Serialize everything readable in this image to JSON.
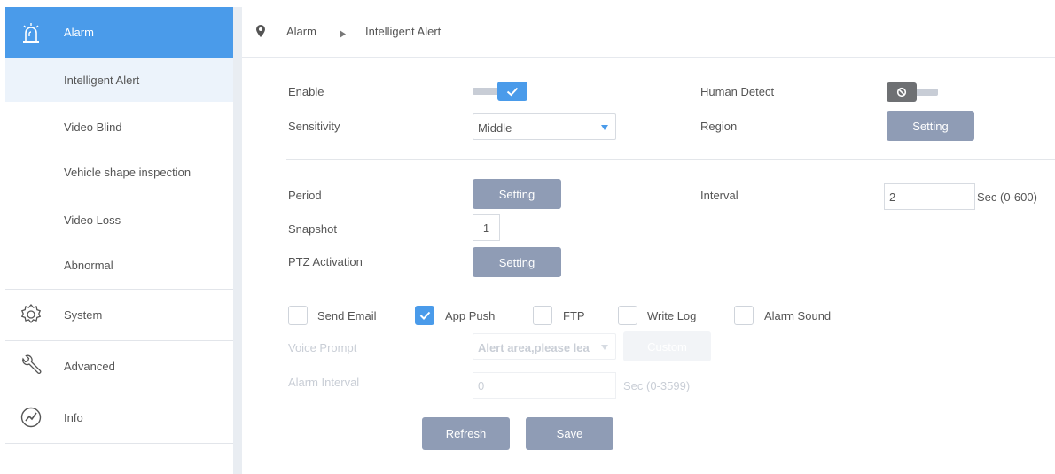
{
  "sidebar": {
    "alarm": "Alarm",
    "sub_items": [
      "Intelligent Alert",
      "Video Blind",
      "Vehicle shape inspection",
      "Video Loss",
      "Abnormal"
    ],
    "system": "System",
    "advanced": "Advanced",
    "info": "Info"
  },
  "breadcrumb": {
    "first": "Alarm",
    "second": "Intelligent Alert"
  },
  "form": {
    "enable_label": "Enable",
    "enable_on": true,
    "human_detect_label": "Human Detect",
    "human_detect_on": false,
    "sensitivity_label": "Sensitivity",
    "sensitivity_value": "Middle",
    "region_label": "Region",
    "region_button": "Setting",
    "period_label": "Period",
    "period_button": "Setting",
    "interval_label": "Interval",
    "interval_value": "2",
    "interval_unit": "Sec (0-600)",
    "snapshot_label": "Snapshot",
    "snapshot_value": "1",
    "ptz_label": "PTZ Activation",
    "ptz_button": "Setting",
    "send_email": "Send Email",
    "app_push": "App Push",
    "ftp": "FTP",
    "write_log": "Write Log",
    "alarm_sound": "Alarm Sound",
    "voice_prompt_label": "Voice Prompt",
    "voice_prompt_value": "Alert area,please lea",
    "custom_button": "Custom",
    "alarm_interval_label": "Alarm Interval",
    "alarm_interval_value": "0",
    "alarm_interval_unit": "Sec (0-3599)"
  },
  "actions": {
    "refresh": "Refresh",
    "save": "Save"
  },
  "colors": {
    "accent": "#4a9bea",
    "button": "#8f9cb5",
    "dark_knob": "#6e7073"
  }
}
